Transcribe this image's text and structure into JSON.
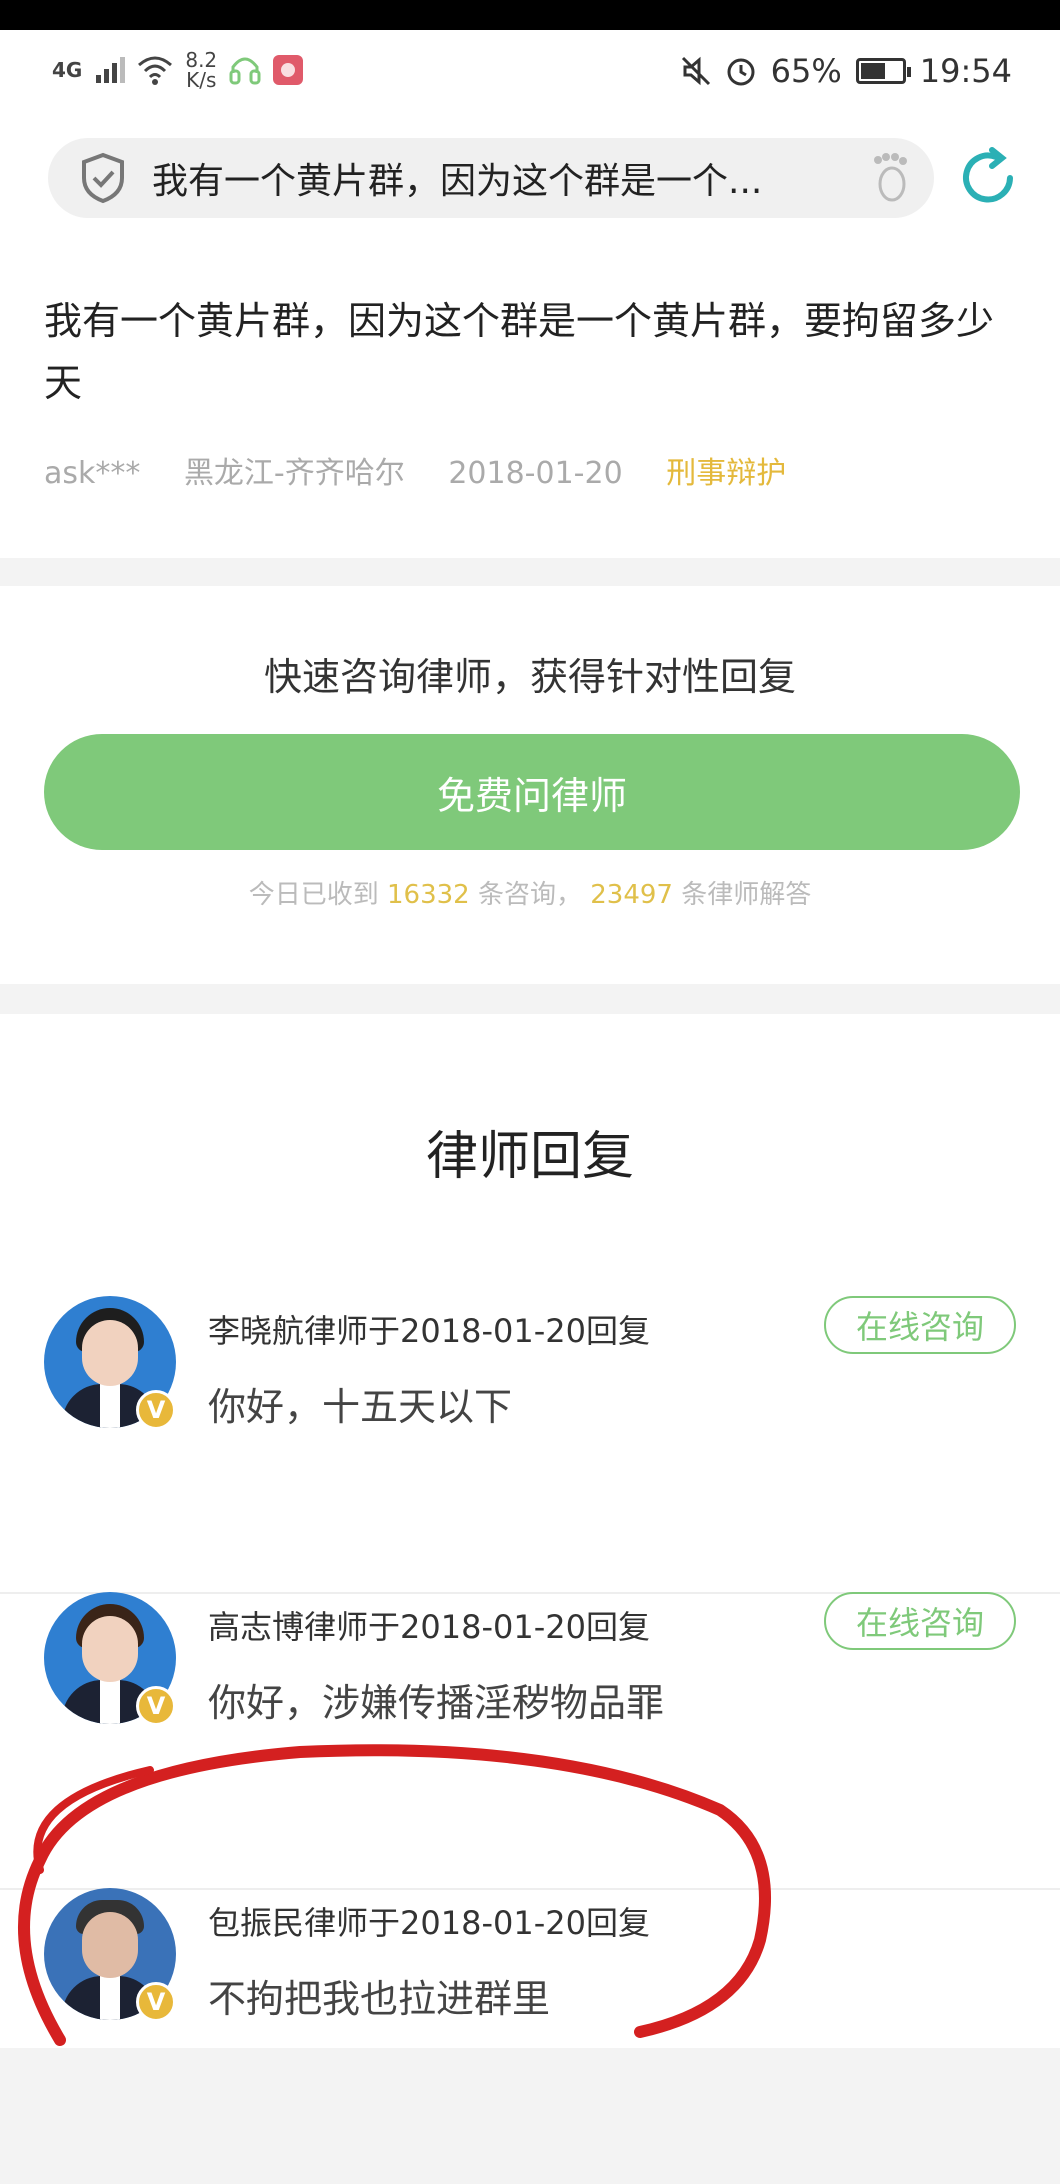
{
  "status_bar": {
    "network": "4G",
    "speed_value": "8.2",
    "speed_unit": "K/s",
    "battery_pct": "65%",
    "battery_level": 0.65,
    "time": "19:54"
  },
  "search": {
    "query": "我有一个黄片群，因为这个群是一个..."
  },
  "question": {
    "title": "我有一个黄片群，因为这个群是一个黄片群，要拘留多少天",
    "user": "ask***",
    "location": "黑龙江-齐齐哈尔",
    "date": "2018-01-20",
    "category": "刑事辩护"
  },
  "consult": {
    "hint": "快速咨询律师，获得针对性回复",
    "button_label": "免费问律师",
    "stats_prefix": "今日已收到",
    "consult_count": "16332",
    "stats_mid": "条咨询，",
    "answer_count": "23497",
    "stats_suffix": "条律师解答"
  },
  "replies": {
    "title": "律师回复",
    "items": [
      {
        "header": "李晓航律师于2018-01-20回复",
        "body": "你好，十五天以下",
        "action": "在线咨询",
        "badge": "V"
      },
      {
        "header": "高志博律师于2018-01-20回复",
        "body": "你好，涉嫌传播淫秽物品罪",
        "action": "在线咨询",
        "badge": "V"
      },
      {
        "header": "包振民律师于2018-01-20回复",
        "body": "不拘把我也拉进群里",
        "badge": "V"
      }
    ]
  },
  "colors": {
    "accent_green": "#7fc97a",
    "category_gold": "#e4b93c",
    "annotation_red": "#d42020"
  }
}
